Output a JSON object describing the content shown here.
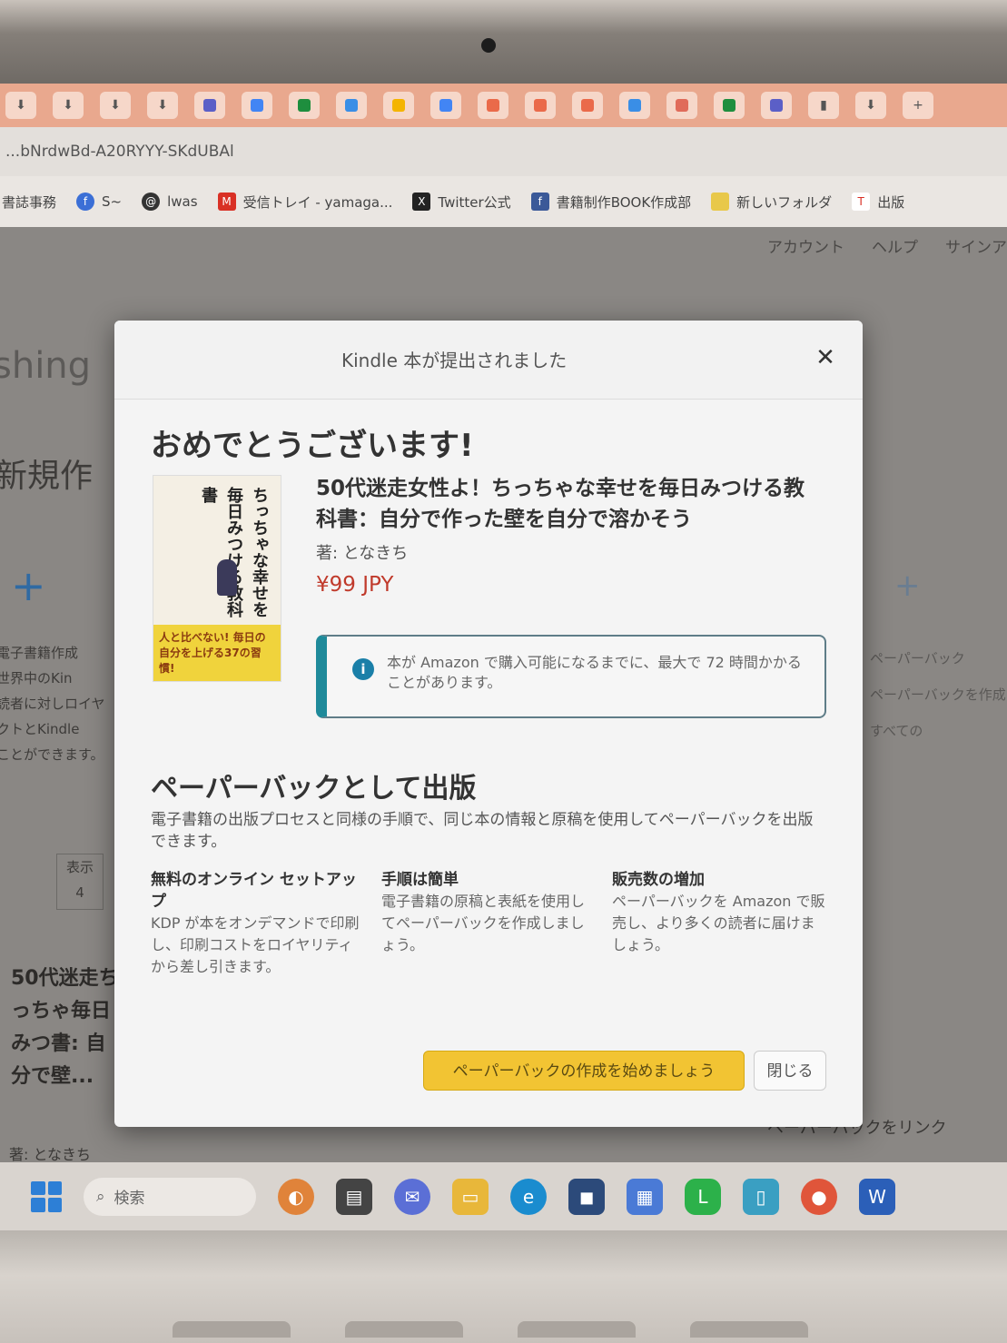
{
  "browser": {
    "address_bar_text": "...bNrdwBd-A20RYYY-SKdUBAl",
    "bookmarks": [
      {
        "label": "書誌事務",
        "icon": "folder-icon"
      },
      {
        "label": "S~",
        "icon": "facebook-icon"
      },
      {
        "label": "lwas",
        "icon": "threads-icon"
      },
      {
        "label": "受信トレイ - yamaga...",
        "icon": "gmail-icon"
      },
      {
        "label": "Twitter公式",
        "icon": "twitter-icon"
      },
      {
        "label": "書籍制作BOOK作成部",
        "icon": "facebook-icon"
      },
      {
        "label": "新しいフォルダ",
        "icon": "folder-icon"
      },
      {
        "label": "出版",
        "icon": "t-icon"
      }
    ]
  },
  "background_page": {
    "top_links": [
      "アカウント",
      "ヘルプ",
      "サインア"
    ],
    "brand_fragment": "shing",
    "section_fragment": "新規作",
    "left_text": [
      "電子書籍作成",
      "世界中のKin",
      "読者に対しロイヤ",
      "クトとKindle",
      "ことができます。"
    ],
    "right_text": [
      "ペーパーバック",
      "ペーパーバックを作成",
      "すべての"
    ],
    "filter_label": "表示",
    "filter_value": "4",
    "book_title_fragment": "50代迷走ちっちゃ毎日みつ書: 自分で壁...",
    "author_fragment": "著: となきち",
    "link_fragment": "ペーパーバックをリンク"
  },
  "modal": {
    "header_title": "Kindle 本が提出されました",
    "congrats": "おめでとうございます!",
    "book": {
      "title": "50代迷走女性よ！ちっちゃな幸せを毎日みつける教科書：自分で作った壁を自分で溶かそう",
      "author": "著: となきち",
      "price": "¥99 JPY",
      "cover_title": "ちっちゃな幸せを毎日みつける教科書",
      "cover_band_text": "人と比べない! 毎日の自分を上げる37の習慣!"
    },
    "info_text": "本が Amazon で購入可能になるまでに、最大で 72 時間かかることがあります。",
    "paperback": {
      "heading": "ペーパーバックとして出版",
      "description": "電子書籍の出版プロセスと同様の手順で、同じ本の情報と原稿を使用してペーパーバックを出版できます。",
      "features": [
        {
          "title": "無料のオンライン セットアップ",
          "body": "KDP が本をオンデマンドで印刷し、印刷コストをロイヤリティから差し引きます。"
        },
        {
          "title": "手順は簡単",
          "body": "電子書籍の原稿と表紙を使用してペーパーバックを作成しましょう。"
        },
        {
          "title": "販売数の増加",
          "body": "ペーパーバックを Amazon で販売し、より多くの読者に届けましょう。"
        }
      ]
    },
    "cta_label": "ペーパーバックの作成を始めましょう",
    "close_label": "閉じる"
  },
  "taskbar": {
    "search_placeholder": "検索",
    "apps": [
      "pizza-icon",
      "file-explorer-icon",
      "chat-icon",
      "folder-icon",
      "edge-icon",
      "store-icon",
      "calendar-icon",
      "line-icon",
      "phone-icon",
      "chrome-icon",
      "word-icon"
    ]
  },
  "colors": {
    "accent_yellow": "#f2c433",
    "price_red": "#c03a2b",
    "info_teal": "#1f8a9a",
    "tabbar": "#e9a88e"
  }
}
